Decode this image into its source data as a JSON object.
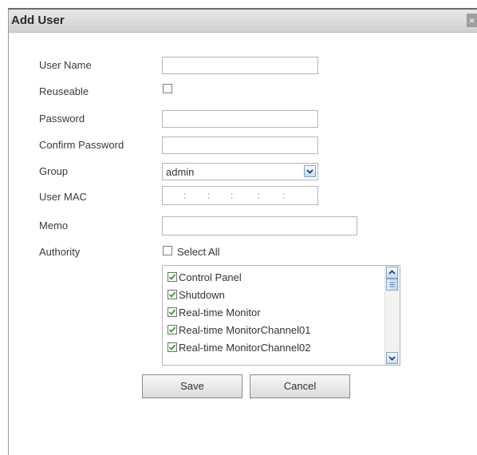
{
  "dialog": {
    "title": "Add User",
    "close_glyph": "×"
  },
  "form": {
    "user_name": {
      "label": "User Name",
      "value": "",
      "placeholder": ""
    },
    "reuseable": {
      "label": "Reuseable",
      "checked": false
    },
    "password": {
      "label": "Password",
      "value": ""
    },
    "confirm_password": {
      "label": "Confirm Password",
      "value": ""
    },
    "group": {
      "label": "Group",
      "selected": "admin"
    },
    "user_mac": {
      "label": "User MAC",
      "separators": [
        ":",
        ":",
        ":",
        ":",
        ":"
      ]
    },
    "memo": {
      "label": "Memo",
      "value": ""
    },
    "authority": {
      "label": "Authority",
      "select_all_label": "Select All",
      "select_all_checked": false,
      "items": [
        {
          "label": "Control Panel",
          "checked": true
        },
        {
          "label": "Shutdown",
          "checked": true
        },
        {
          "label": "Real-time Monitor",
          "checked": true
        },
        {
          "label": "Real-time MonitorChannel01",
          "checked": true
        },
        {
          "label": "Real-time MonitorChannel02",
          "checked": true
        }
      ]
    }
  },
  "buttons": {
    "save": "Save",
    "cancel": "Cancel"
  },
  "icons": {
    "checkmark_color": "#3c9a2e",
    "scroll_arrow_color": "#1f3f70"
  }
}
